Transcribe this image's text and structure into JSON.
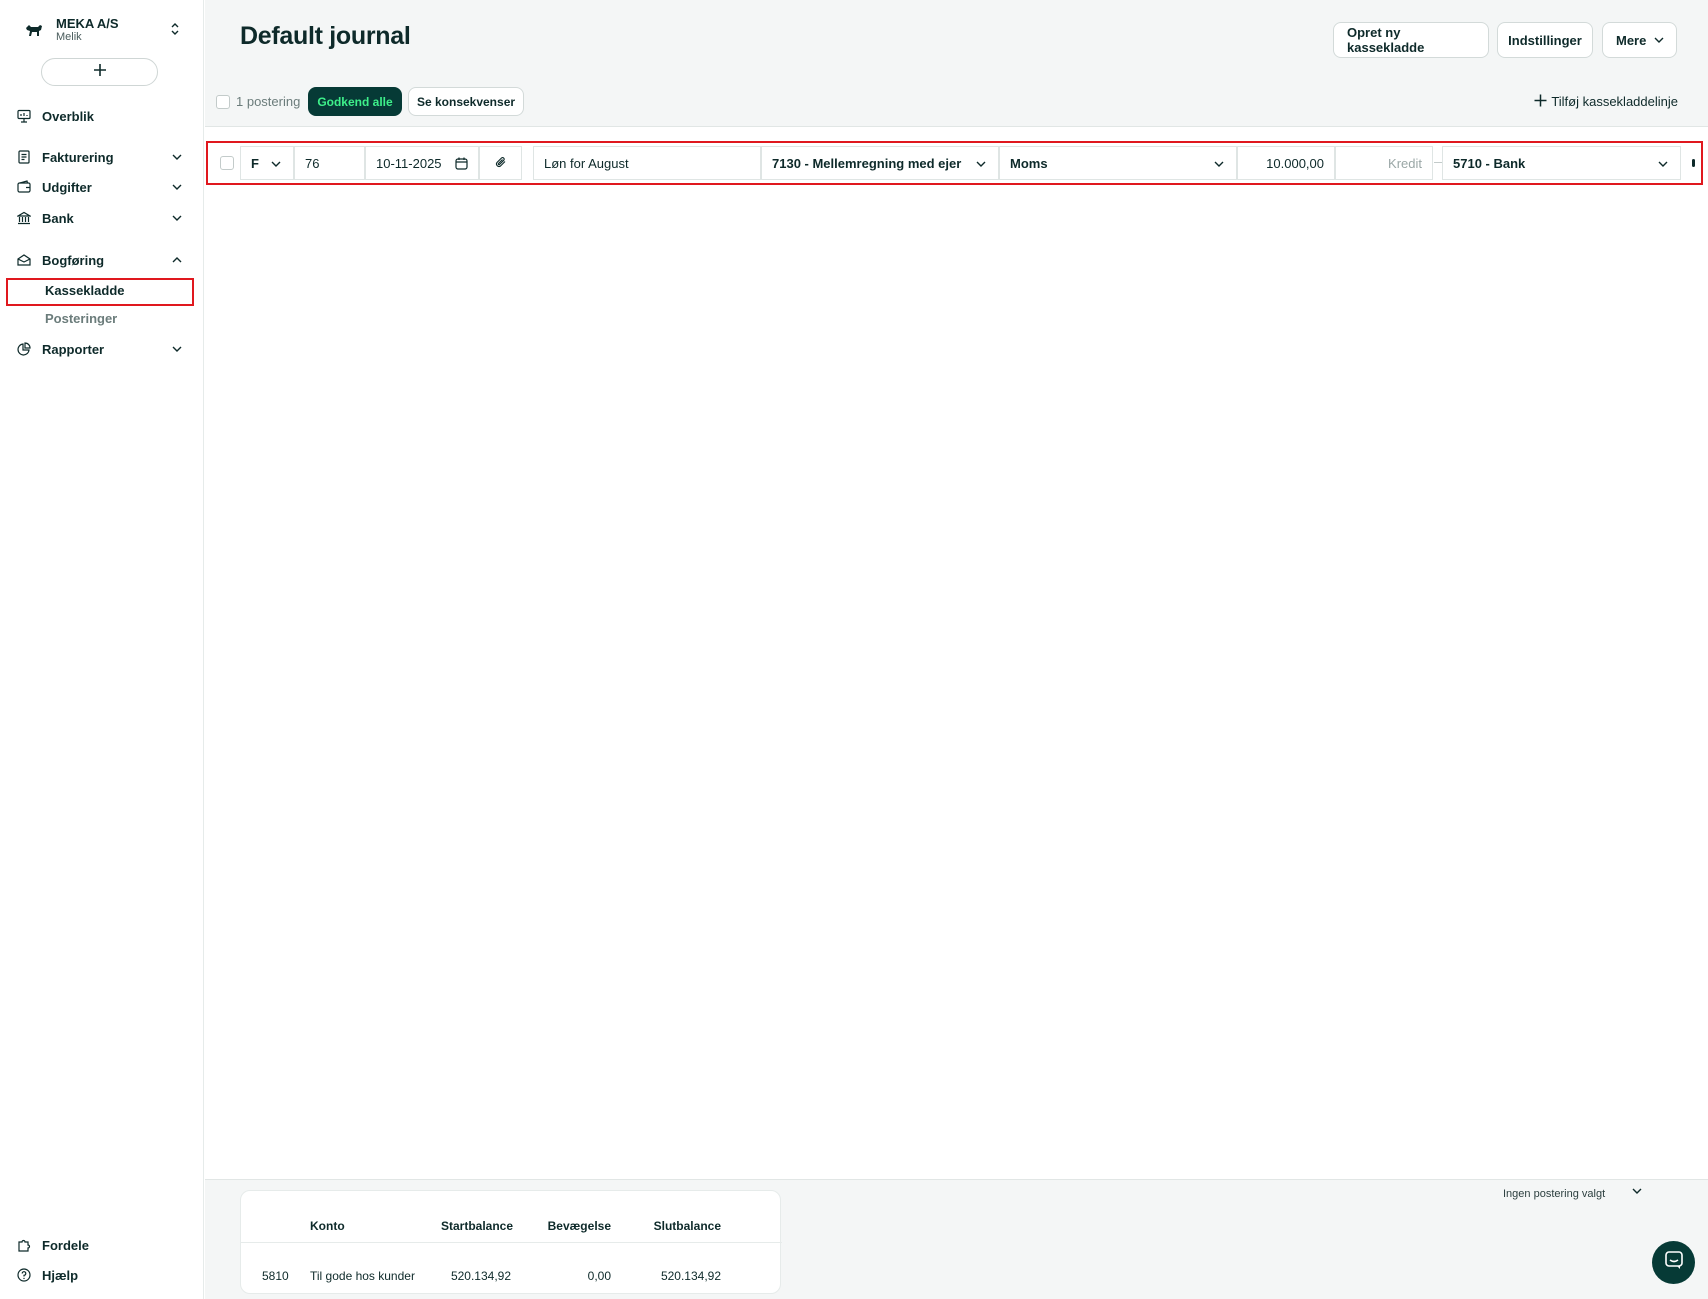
{
  "company": {
    "name": "MEKA A/S",
    "user": "Melik"
  },
  "sidebar": {
    "add_label": "+",
    "items": [
      {
        "label": "Overblik",
        "icon": "presentation-icon"
      },
      {
        "label": "Fakturering",
        "icon": "invoice-icon"
      },
      {
        "label": "Udgifter",
        "icon": "wallet-icon"
      },
      {
        "label": "Bank",
        "icon": "bank-icon"
      },
      {
        "label": "Bogføring",
        "icon": "ledger-icon"
      },
      {
        "label": "Rapporter",
        "icon": "pie-chart-icon"
      }
    ],
    "sub_items": [
      {
        "label": "Kassekladde",
        "active": true
      },
      {
        "label": "Posteringer",
        "active": false
      }
    ],
    "bottom": [
      {
        "label": "Fordele",
        "icon": "puzzle-icon"
      },
      {
        "label": "Hjælp",
        "icon": "help-icon"
      }
    ]
  },
  "header": {
    "title": "Default journal",
    "buttons": {
      "create": "Opret ny kassekladde",
      "settings": "Indstillinger",
      "more": "Mere"
    }
  },
  "toolbar": {
    "count": "1 postering",
    "approve_all": "Godkend alle",
    "consequences": "Se konsekvenser",
    "add_line": "Tilføj kassekladdelinje"
  },
  "journal_row": {
    "type": "F",
    "voucher": "76",
    "date": "10-11-2025",
    "description": "Løn for August",
    "account": "7130 - Mellemregning med ejer",
    "vat": "Moms",
    "debit": "10.000,00",
    "credit_placeholder": "Kredit",
    "contra_account": "5710 - Bank"
  },
  "balance": {
    "headers": {
      "account": "Konto",
      "start": "Startbalance",
      "movement": "Bevægelse",
      "end": "Slutbalance"
    },
    "rows": [
      {
        "number": "5810",
        "name": "Til gode hos kunder",
        "start": "520.134,92",
        "movement": "0,00",
        "end": "520.134,92"
      }
    ]
  },
  "footer": {
    "no_selection": "Ingen postering valgt"
  },
  "colors": {
    "brand_dark": "#063a36",
    "brand_green": "#3ef08a",
    "highlight_red": "#e0181e"
  }
}
